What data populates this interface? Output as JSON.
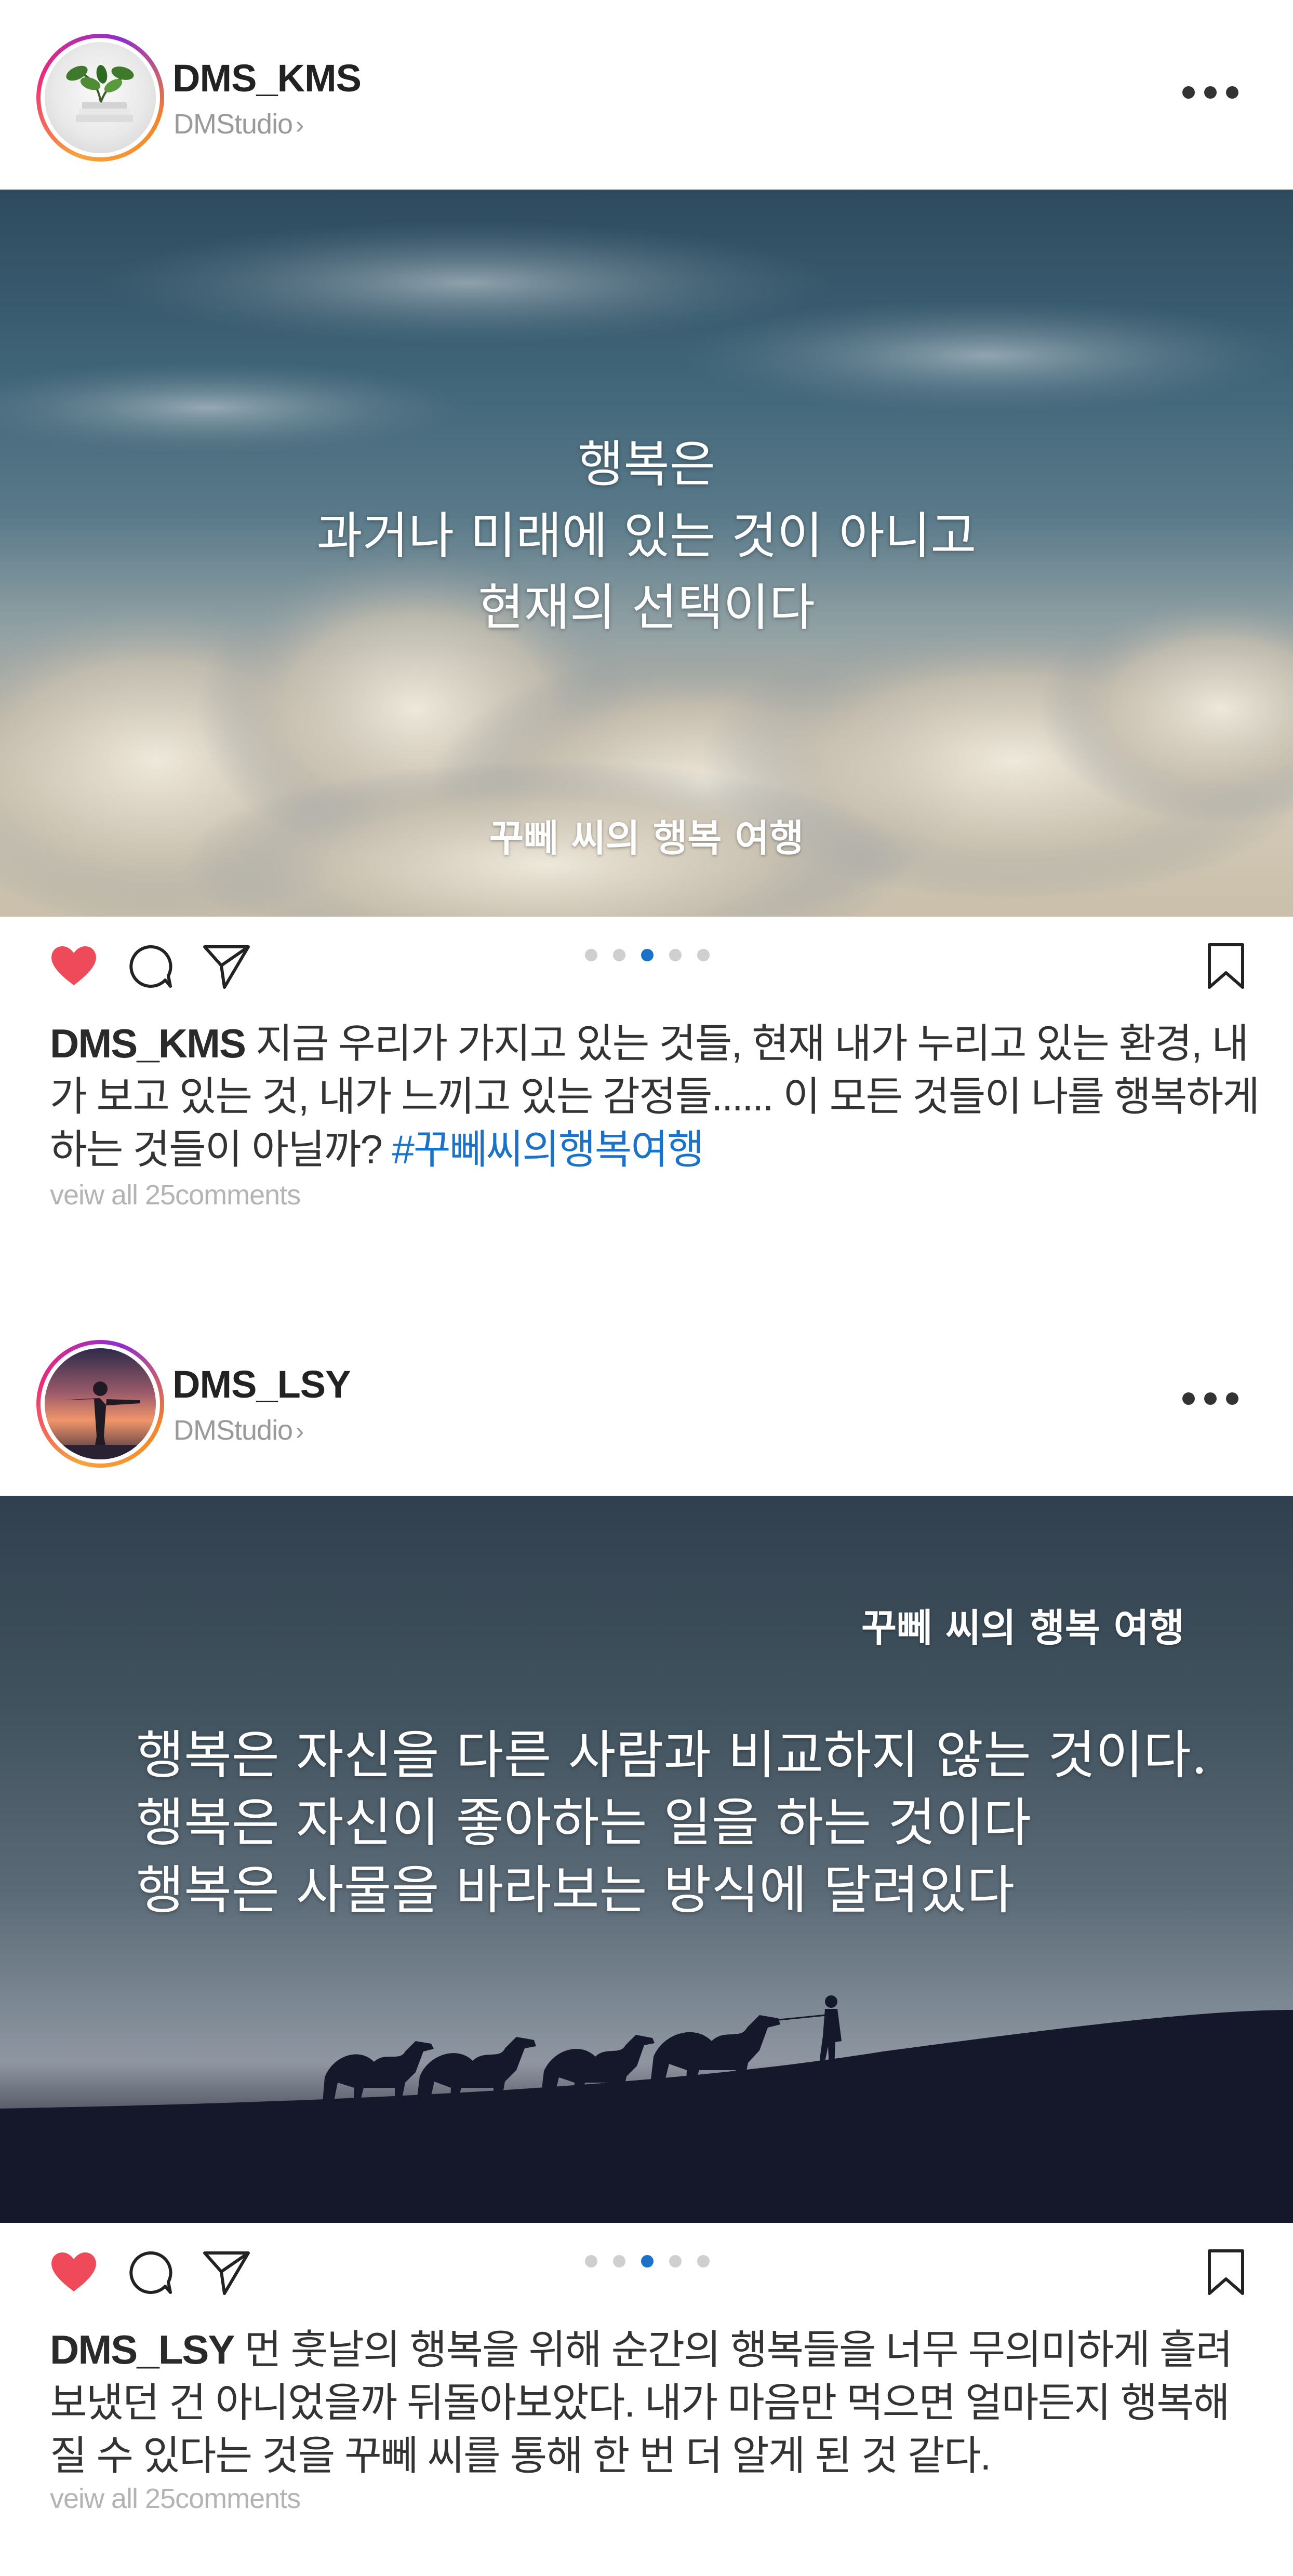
{
  "posts": [
    {
      "username": "DMS_KMS",
      "subtitle": "DMStudio",
      "chevron": "›",
      "image_quote_lines": [
        "행복은",
        "과거나 미래에 있는 것이 아니고",
        "현재의 선택이다"
      ],
      "image_caption": "꾸뻬 씨의 행복 여행",
      "carousel": {
        "count": 5,
        "active_index": 2
      },
      "caption_username": "DMS_KMS",
      "caption_text": " 지금 우리가 가지고 있는 것들, 현재 내가 누리고 있는 환경, 내가 보고 있는 것, 내가 느끼고 있는 감정들...... 이 모든 것들이 나를 행복하게 하는 것들이 아닐까? ",
      "hashtag": "#꾸뻬씨의행복여행",
      "comments_link": "veiw all 25comments",
      "liked": true
    },
    {
      "username": "DMS_LSY",
      "subtitle": "DMStudio",
      "chevron": "›",
      "image_quote_lines": [
        "행복은 자신을 다른 사람과 비교하지 않는 것이다.",
        "행복은 자신이 좋아하는 일을 하는 것이다",
        "행복은 사물을 바라보는 방식에 달려있다"
      ],
      "image_caption": "꾸뻬 씨의 행복 여행",
      "carousel": {
        "count": 5,
        "active_index": 2
      },
      "caption_username": "DMS_LSY",
      "caption_text": " 먼 훗날의 행복을 위해 순간의 행복들을 너무 무의미하게 흘려보냈던 건 아니었을까 뒤돌아보았다. 내가 마음만 먹으면 얼마든지 행복해질 수 있다는 것을 꾸뻬 씨를 통해 한 번 더 알게 된 것 같다.",
      "hashtag": "",
      "comments_link": "veiw all 25comments",
      "liked": true
    }
  ],
  "icons": {
    "like": "heart-icon",
    "comment": "comment-bubble-icon",
    "share": "paper-plane-icon",
    "save": "bookmark-icon",
    "more": "more-dots-icon"
  },
  "colors": {
    "like": "#ef4a5a",
    "hashtag": "#1a73c8",
    "carousel_active": "#1a73c8",
    "carousel_inactive": "#cfcfcf",
    "muted_text": "#9a9a9a",
    "avatar_ring_start": "#f7a33a",
    "avatar_ring_end": "#8e2ecf"
  }
}
